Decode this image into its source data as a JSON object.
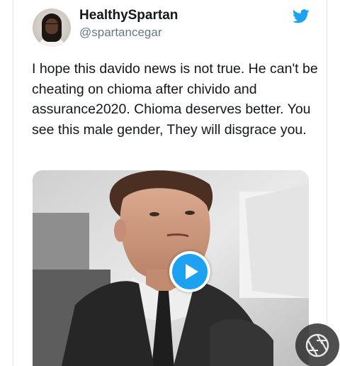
{
  "tweet": {
    "display_name": "HealthySpartan",
    "handle": "@spartancegar",
    "text": "I hope this davido news is not true. He can't be cheating on chioma after chivido and assurance2020. Chioma deserves better. You see this male gender, They will disgrace you."
  },
  "icons": {
    "brand": "twitter-bird-icon",
    "play": "play-icon",
    "overlay": "camera-aperture-icon"
  },
  "colors": {
    "twitter_blue": "#1da1f2",
    "name_text": "#14171a",
    "handle_text": "#657786"
  }
}
